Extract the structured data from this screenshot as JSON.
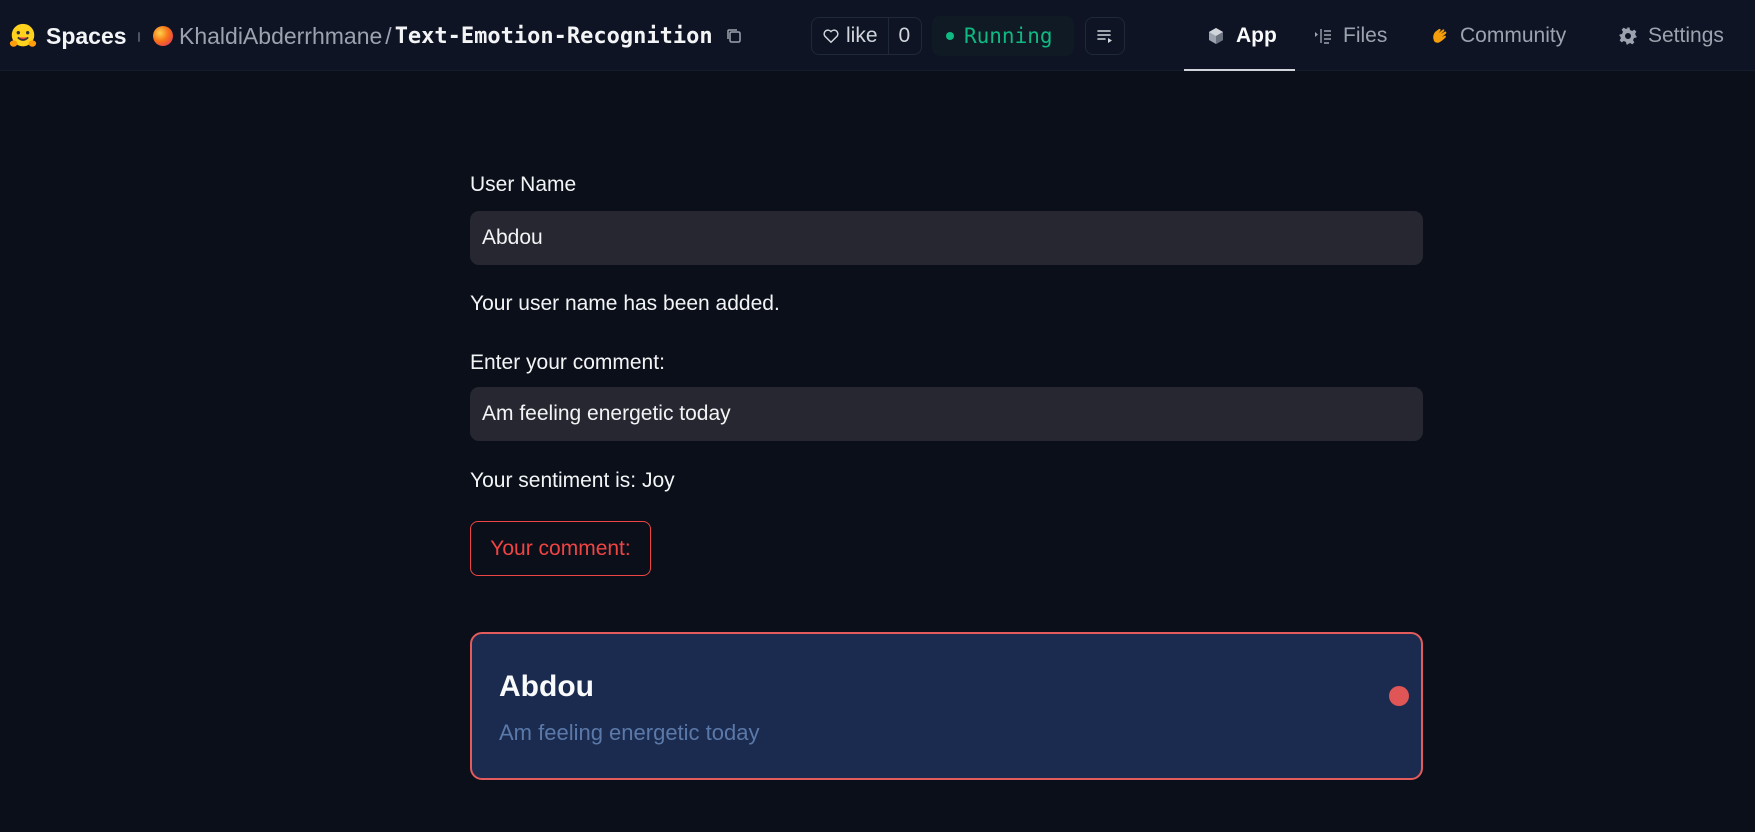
{
  "header": {
    "brand": "Spaces",
    "owner": "KhaldiAbderrhmane",
    "separator": "/",
    "repo": "Text-Emotion-Recognition",
    "like_label": "like",
    "like_count": "0",
    "status": "Running",
    "tabs": [
      {
        "label": "App",
        "icon": "cube-icon",
        "active": true
      },
      {
        "label": "Files",
        "icon": "files-icon",
        "active": false
      },
      {
        "label": "Community",
        "icon": "clapping-hands-icon",
        "active": false
      },
      {
        "label": "Settings",
        "icon": "gear-icon",
        "active": false
      }
    ]
  },
  "form": {
    "username_label": "User Name",
    "username_value": "Abdou",
    "username_message": "Your user name has been added.",
    "comment_label": "Enter your comment:",
    "comment_value": "Am feeling energetic today",
    "sentiment_message": "Your sentiment is: Joy",
    "comment_button": "Your comment:"
  },
  "card": {
    "name": "Abdou",
    "comment": "Am feeling energetic today"
  },
  "colors": {
    "background": "#0b0f19",
    "input_bg": "#262730",
    "accent_red": "#ef4444",
    "card_bg": "#1a2b4f",
    "running_green": "#10b981"
  }
}
